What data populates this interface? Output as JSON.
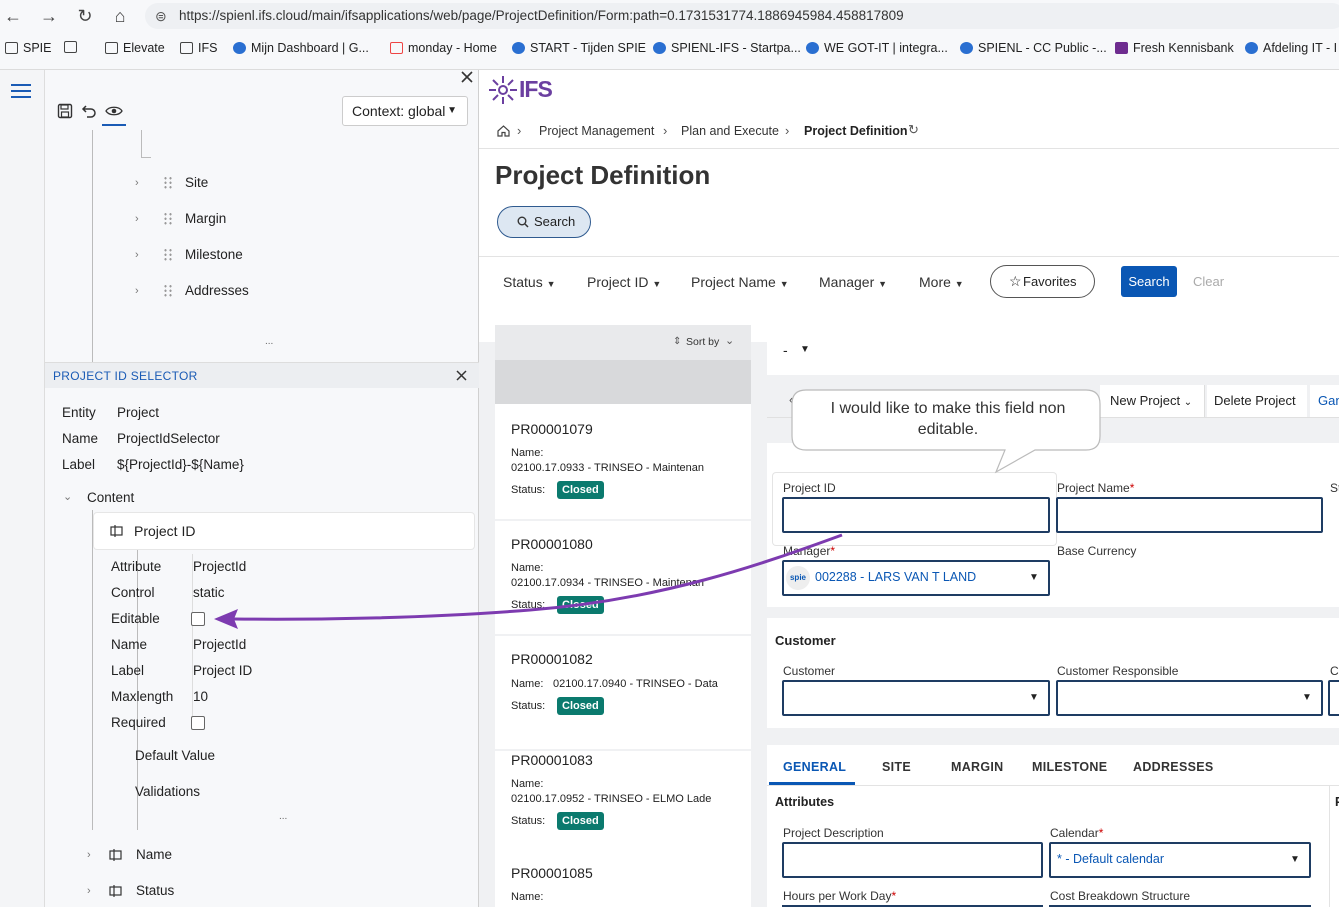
{
  "browser": {
    "url": "https://spienl.ifs.cloud/main/ifsapplications/web/page/ProjectDefinition/Form:path=0.1731531774.1886945984.458817809",
    "nav": {
      "back": "←",
      "forward": "→",
      "reload": "↻",
      "home": "⌂",
      "site_info": "⊜"
    },
    "bookmarks": [
      "SPIE",
      "Elevate",
      "IFS",
      "Mijn Dashboard | G...",
      "monday - Home",
      "START - Tijden SPIE",
      "SPIENL-IFS - Startpa...",
      "WE GOT-IT | integra...",
      "SPIENL - CC Public -...",
      "Fresh Kennisbank",
      "Afdeling IT - I"
    ]
  },
  "designer": {
    "context_label": "Context: global",
    "tree_top": [
      "Site",
      "Margin",
      "Milestone",
      "Addresses"
    ],
    "ellipsis": "...",
    "panel_title": "PROJECT ID SELECTOR",
    "entity_label": "Entity",
    "entity_value": "Project",
    "name_label": "Name",
    "name_value": "ProjectIdSelector",
    "label_label": "Label",
    "label_value": "${ProjectId}-${Name}",
    "content": "Content",
    "project_id_node": "Project ID",
    "props": [
      {
        "k": "Attribute",
        "v": "ProjectId"
      },
      {
        "k": "Control",
        "v": "static"
      },
      {
        "k": "Editable",
        "v": ""
      },
      {
        "k": "Name",
        "v": "ProjectId"
      },
      {
        "k": "Label",
        "v": "Project ID"
      },
      {
        "k": "Maxlength",
        "v": "10"
      },
      {
        "k": "Required",
        "v": ""
      }
    ],
    "default_value": "Default Value",
    "validations": "Validations",
    "bottom_nodes": [
      "Name",
      "Status"
    ]
  },
  "app": {
    "logo": "IFS",
    "breadcrumb": [
      "Project Management",
      "Plan and Execute",
      "Project Definition"
    ],
    "page_title": "Project Definition",
    "search_button": "Search",
    "filters": [
      "Status",
      "Project ID",
      "Project Name",
      "Manager",
      "More"
    ],
    "favorites": "Favorites",
    "search": "Search",
    "clear": "Clear",
    "sort_by": "Sort by",
    "records": [
      {
        "id": "PR00001079",
        "name_label": "Name:",
        "name": "02100.17.0933 - TRINSEO - Maintenan",
        "status_label": "Status:",
        "status": "Closed"
      },
      {
        "id": "PR00001080",
        "name_label": "Name:",
        "name": "02100.17.0934 - TRINSEO - Maintenan",
        "status_label": "Status:",
        "status": "Closed"
      },
      {
        "id": "PR00001082",
        "name_label": "Name:",
        "name": "02100.17.0940 - TRINSEO - Data",
        "status_label": "Status:",
        "status": "Closed"
      },
      {
        "id": "PR00001083",
        "name_label": "Name:",
        "name": "02100.17.0952 - TRINSEO - ELMO Lade",
        "status_label": "Status:",
        "status": "Closed"
      },
      {
        "id": "PR00001085",
        "name_label": "Name:",
        "name": "",
        "status_label": "",
        "status": ""
      }
    ],
    "record_selector": "-",
    "new_project": "New Project",
    "delete_project": "Delete Project",
    "gan": "Gan",
    "callout": "I would like to make this field non editable.",
    "form": {
      "project_id": "Project ID",
      "project_name": "Project Name",
      "st": "St",
      "manager": "Manager",
      "manager_value": "002288 - LARS VAN T LAND",
      "base_currency": "Base Currency",
      "customer_section": "Customer",
      "customer": "Customer",
      "customer_responsible": "Customer Responsible",
      "c": "C"
    },
    "tabs": [
      "GENERAL",
      "SITE",
      "MARGIN",
      "MILESTONE",
      "ADDRESSES"
    ],
    "attributes": "Attributes",
    "p": "P",
    "project_description": "Project Description",
    "calendar": "Calendar",
    "calendar_value": "* - Default calendar",
    "hours_per_work_day": "Hours per Work Day",
    "cost_breakdown": "Cost Breakdown Structure",
    "required_mark": "*"
  },
  "colors": {
    "accent": "#0a57b4",
    "closed": "#0b7a6e",
    "arrow": "#7d3bb0",
    "field_border": "#1e3c63"
  }
}
